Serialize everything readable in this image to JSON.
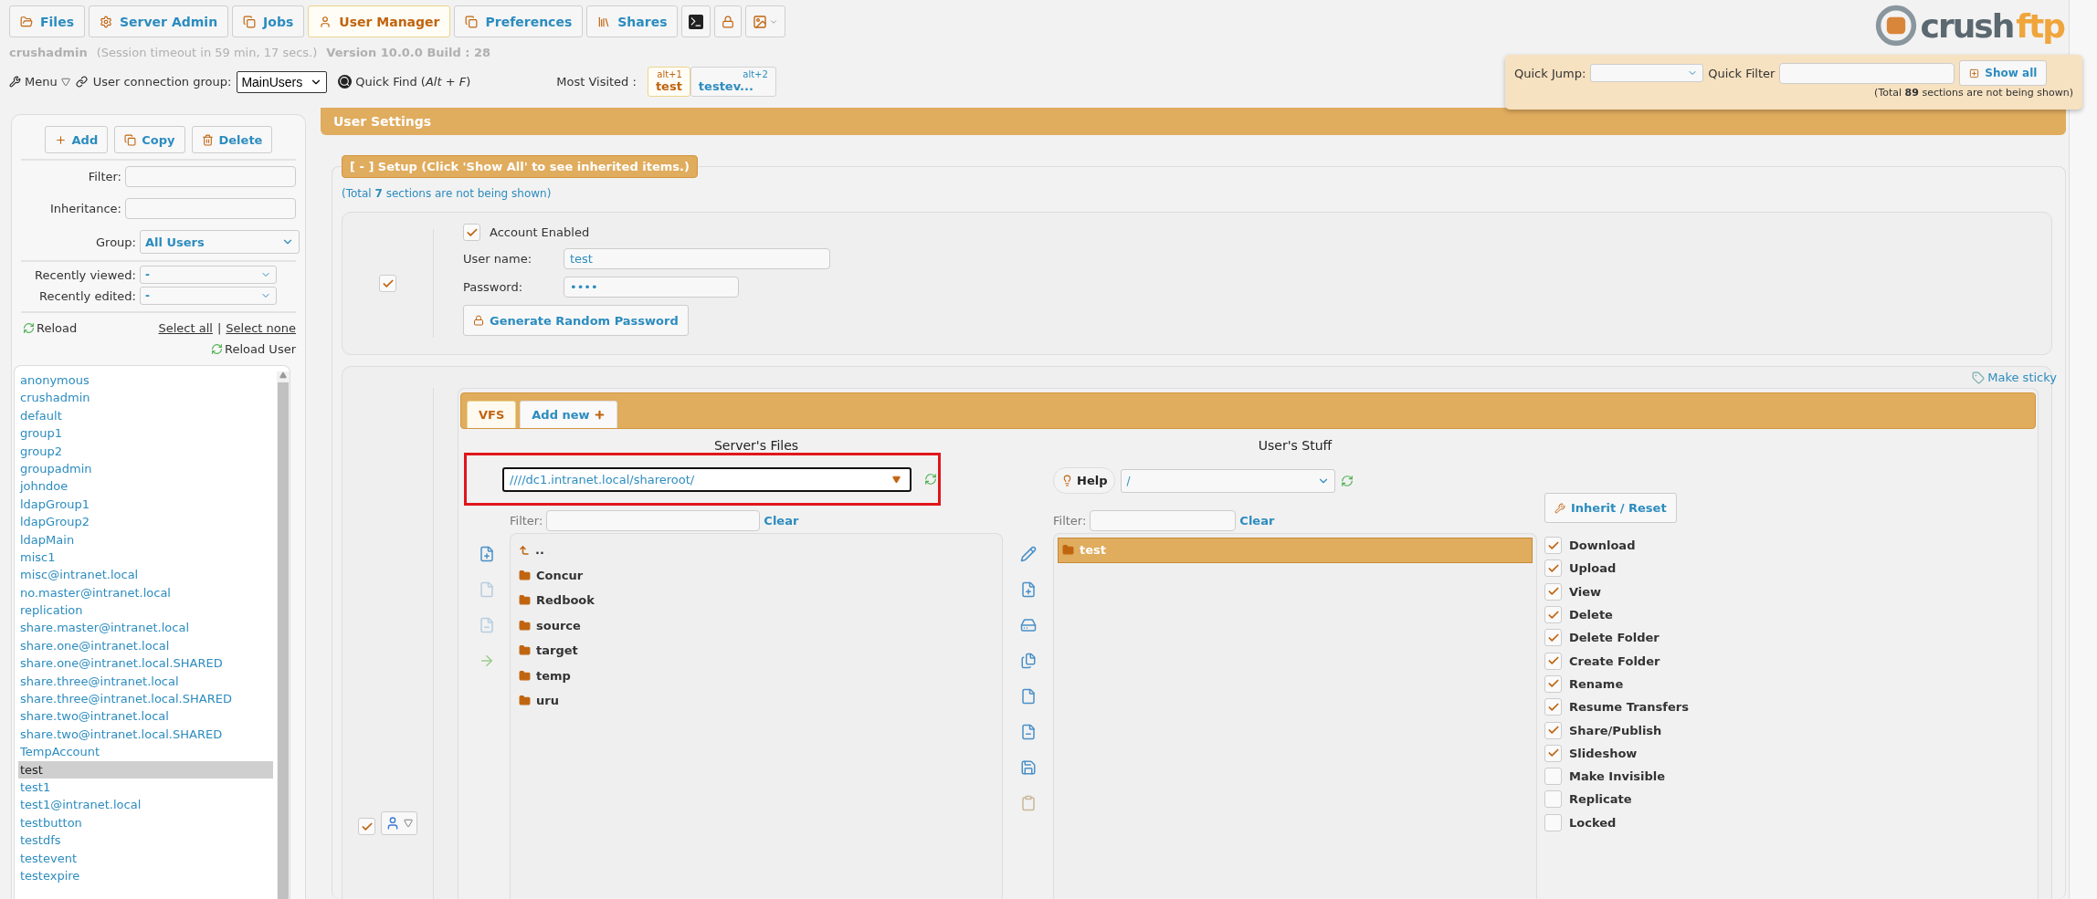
{
  "nav_tabs": [
    {
      "label": "Files",
      "selected": false
    },
    {
      "label": "Server Admin",
      "selected": false
    },
    {
      "label": "Jobs",
      "selected": false
    },
    {
      "label": "User Manager",
      "selected": true
    },
    {
      "label": "Preferences",
      "selected": false
    },
    {
      "label": "Shares",
      "selected": false
    }
  ],
  "session": {
    "user": "crushadmin",
    "timeout": "(Session timeout in 59 min, 17 secs.)",
    "version": "Version 10.0.0 Build : 28"
  },
  "toolbar": {
    "menu": "Menu",
    "group_label": "User connection group:",
    "group": "MainUsers",
    "quick_find": "Quick Find",
    "quick_find_keys": "(*Alt* + *F*)"
  },
  "most_visited": {
    "label": "Most Visited :",
    "items": [
      {
        "shortcut": "alt+1",
        "name": "test",
        "selected": true
      },
      {
        "shortcut": "alt+2",
        "name": "testev...",
        "selected": false
      }
    ]
  },
  "logo": {
    "text": "crush",
    "accent": "ftp"
  },
  "quick_jump": {
    "label": "Quick Jump:",
    "filter_label": "Quick Filter",
    "button": "Show all",
    "note": "(Total **89** sections are not being shown)"
  },
  "sidebar": {
    "buttons": [
      "Add",
      "Copy",
      "Delete"
    ],
    "filter_label": "Filter:",
    "inheritance_label": "Inheritance:",
    "group_label": "Group:",
    "group": "All Users",
    "recently_viewed_label": "Recently viewed:",
    "recently_viewed": "-",
    "recently_edited_label": "Recently edited:",
    "recently_edited": "-",
    "reload": "Reload",
    "select_all": "Select all",
    "separator": "|",
    "select_none": "Select none",
    "reload_user": "Reload User",
    "users": [
      {
        "name": "anonymous",
        "selected": false
      },
      {
        "name": "crushadmin",
        "selected": false
      },
      {
        "name": "default",
        "selected": false
      },
      {
        "name": "group1",
        "selected": false
      },
      {
        "name": "group2",
        "selected": false
      },
      {
        "name": "groupadmin",
        "selected": false
      },
      {
        "name": "johndoe",
        "selected": false
      },
      {
        "name": "ldapGroup1",
        "selected": false
      },
      {
        "name": "ldapGroup2",
        "selected": false
      },
      {
        "name": "ldapMain",
        "selected": false
      },
      {
        "name": "misc1",
        "selected": false
      },
      {
        "name": "misc@intranet.local",
        "selected": false
      },
      {
        "name": "no.master@intranet.local",
        "selected": false
      },
      {
        "name": "replication",
        "selected": false
      },
      {
        "name": "share.master@intranet.local",
        "selected": false
      },
      {
        "name": "share.one@intranet.local",
        "selected": false
      },
      {
        "name": "share.one@intranet.local.SHARED",
        "selected": false
      },
      {
        "name": "share.three@intranet.local",
        "selected": false
      },
      {
        "name": "share.three@intranet.local.SHARED",
        "selected": false
      },
      {
        "name": "share.two@intranet.local",
        "selected": false
      },
      {
        "name": "share.two@intranet.local.SHARED",
        "selected": false
      },
      {
        "name": "TempAccount",
        "selected": false
      },
      {
        "name": "test",
        "selected": true
      },
      {
        "name": "test1",
        "selected": false
      },
      {
        "name": "test1@intranet.local",
        "selected": false
      },
      {
        "name": "testbutton",
        "selected": false
      },
      {
        "name": "testdfs",
        "selected": false
      },
      {
        "name": "testevent",
        "selected": false
      },
      {
        "name": "testexpire",
        "selected": false
      }
    ]
  },
  "user_settings": {
    "title": "User Settings"
  },
  "setup": {
    "legend": "[ - ] Setup (Click 'Show All' to see inherited items.)",
    "hidden_note": "(Total **7** sections are not being shown)",
    "section_checked": true,
    "account_enabled": {
      "label": "Account Enabled",
      "checked": true
    },
    "username_label": "User name:",
    "username": "test",
    "password_label": "Password:",
    "password": "••••",
    "generate_button": "Generate Random Password"
  },
  "vfs": {
    "make_sticky": "Make sticky",
    "section_checked": true,
    "tabs": [
      {
        "label": "VFS",
        "selected": true
      },
      {
        "label": "Add new",
        "selected": false
      }
    ],
    "server_title": "Server's Files",
    "server_path": "////dc1.intranet.local/shareroot/",
    "server_path_highlighted": true,
    "filter_label": "Filter:",
    "clear": "Clear",
    "server_items": [
      {
        "name": "..",
        "kind": "parent"
      },
      {
        "name": "Concur",
        "kind": "folder"
      },
      {
        "name": "Redbook",
        "kind": "folder"
      },
      {
        "name": "source",
        "kind": "folder"
      },
      {
        "name": "target",
        "kind": "folder"
      },
      {
        "name": "temp",
        "kind": "folder"
      },
      {
        "name": "uru",
        "kind": "folder"
      }
    ],
    "user_title": "User's Stuff",
    "help": "Help",
    "user_path": "/",
    "user_filter_label": "Filter:",
    "user_clear": "Clear",
    "user_items": [
      {
        "name": "test",
        "selected": true
      }
    ],
    "inherit_button": "Inherit / Reset",
    "permissions": [
      {
        "label": "Download",
        "checked": true
      },
      {
        "label": "Upload",
        "checked": true
      },
      {
        "label": "View",
        "checked": true
      },
      {
        "label": "Delete",
        "checked": true
      },
      {
        "label": "Delete Folder",
        "checked": true
      },
      {
        "label": "Create Folder",
        "checked": true
      },
      {
        "label": "Rename",
        "checked": true
      },
      {
        "label": "Resume Transfers",
        "checked": true
      },
      {
        "label": "Share/Publish",
        "checked": true
      },
      {
        "label": "Slideshow",
        "checked": true
      },
      {
        "label": "Make Invisible",
        "checked": false
      },
      {
        "label": "Replicate",
        "checked": false
      },
      {
        "label": "Locked",
        "checked": false
      }
    ]
  }
}
